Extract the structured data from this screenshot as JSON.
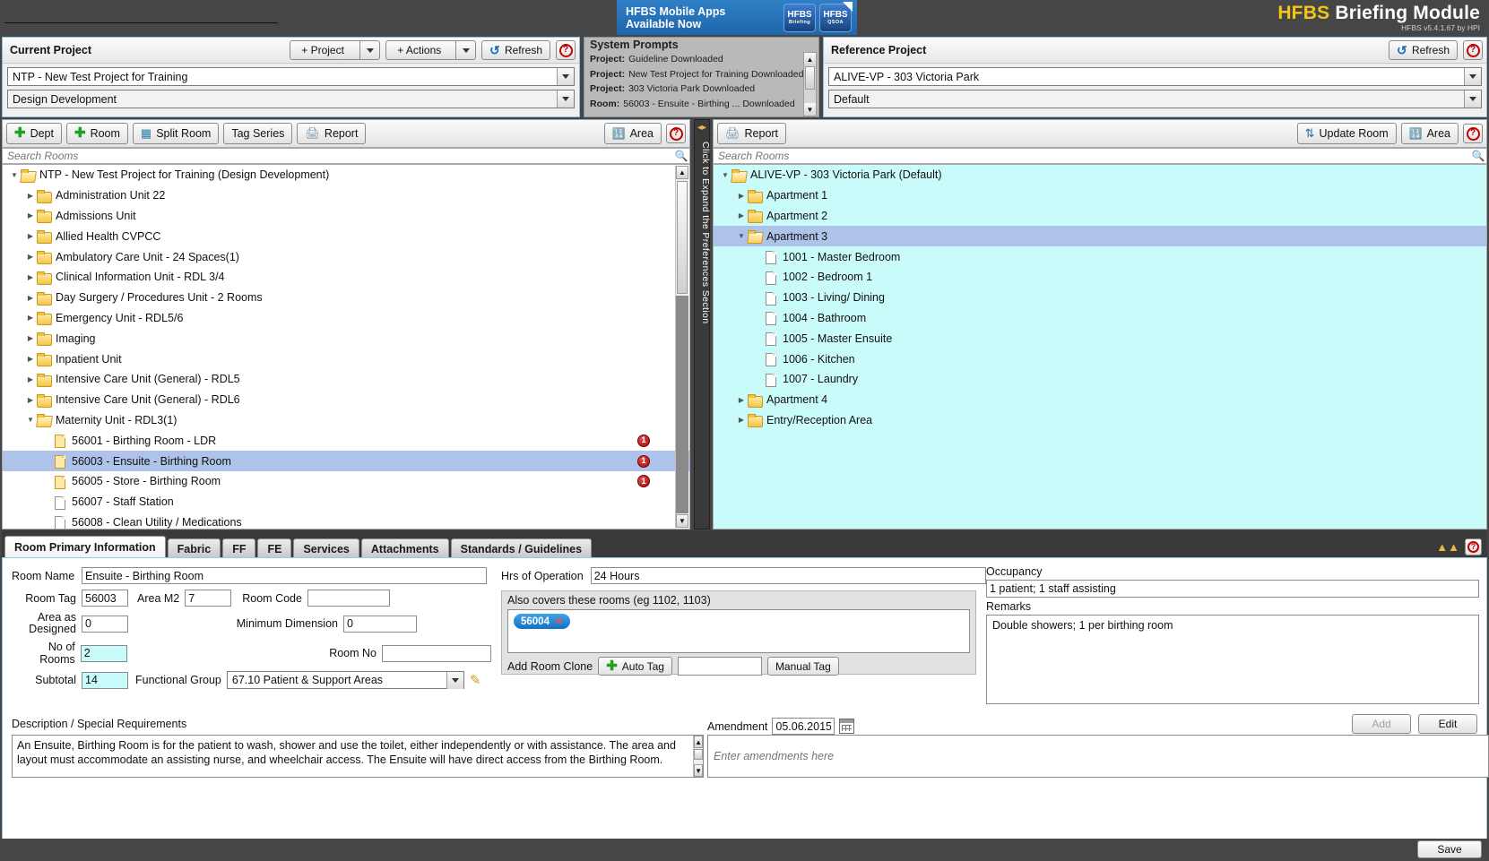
{
  "app": {
    "brand_prefix": "HFBS",
    "brand_title": "Briefing Module",
    "version": "HFBS v5.4.1.67 by HPI"
  },
  "promo": {
    "line1": "HFBS Mobile Apps",
    "line2": "Available Now",
    "icon1_label": "HFBS",
    "icon1_sub": "Briefing",
    "icon2_label": "HFBS",
    "icon2_sub": "QSOA"
  },
  "current_project": {
    "title": "Current Project",
    "add_project_label": "+ Project",
    "add_actions_label": "+ Actions",
    "refresh_label": "Refresh",
    "project_value": "NTP - New Test Project for Training",
    "stage_value": "Design Development"
  },
  "system_prompts": {
    "title": "System Prompts",
    "rows": [
      {
        "label": "Project:",
        "text": "Guideline Downloaded"
      },
      {
        "label": "Project:",
        "text": "New Test Project for Training  Downloaded"
      },
      {
        "label": "Project:",
        "text": "303 Victoria Park  Downloaded"
      },
      {
        "label": "Room:",
        "text": "56003 - Ensuite - Birthing ...  Downloaded"
      }
    ]
  },
  "reference_project": {
    "title": "Reference Project",
    "refresh_label": "Refresh",
    "project_value": "ALIVE-VP - 303 Victoria Park",
    "stage_value": "Default"
  },
  "left_toolbar": {
    "dept_label": "Dept",
    "room_label": "Room",
    "split_room_label": "Split Room",
    "tag_series_label": "Tag Series",
    "report_label": "Report",
    "area_label": "Area"
  },
  "right_toolbar": {
    "report_label": "Report",
    "update_room_label": "Update Room",
    "area_label": "Area"
  },
  "search": {
    "left_placeholder": "Search Rooms",
    "right_placeholder": "Search Rooms"
  },
  "splitter": {
    "label": "Click to Expand the Preferences Section"
  },
  "left_tree": [
    {
      "label": "NTP - New Test Project for Training (Design Development)",
      "indent": 0,
      "icon": "folder-open",
      "twisty": "down",
      "badge": ""
    },
    {
      "label": "Administration Unit 22",
      "indent": 1,
      "icon": "folder",
      "twisty": "right",
      "badge": ""
    },
    {
      "label": "Admissions Unit",
      "indent": 1,
      "icon": "folder",
      "twisty": "right",
      "badge": ""
    },
    {
      "label": "Allied Health CVPCC",
      "indent": 1,
      "icon": "folder",
      "twisty": "right",
      "badge": ""
    },
    {
      "label": "Ambulatory Care Unit - 24 Spaces(1)",
      "indent": 1,
      "icon": "folder",
      "twisty": "right",
      "badge": ""
    },
    {
      "label": "Clinical Information Unit - RDL 3/4",
      "indent": 1,
      "icon": "folder",
      "twisty": "right",
      "badge": ""
    },
    {
      "label": "Day Surgery / Procedures Unit - 2 Rooms",
      "indent": 1,
      "icon": "folder",
      "twisty": "right",
      "badge": ""
    },
    {
      "label": "Emergency Unit - RDL5/6",
      "indent": 1,
      "icon": "folder",
      "twisty": "right",
      "badge": ""
    },
    {
      "label": "Imaging",
      "indent": 1,
      "icon": "folder",
      "twisty": "right",
      "badge": ""
    },
    {
      "label": "Inpatient Unit",
      "indent": 1,
      "icon": "folder",
      "twisty": "right",
      "badge": ""
    },
    {
      "label": "Intensive Care Unit (General) - RDL5",
      "indent": 1,
      "icon": "folder",
      "twisty": "right",
      "badge": ""
    },
    {
      "label": "Intensive Care Unit (General) - RDL6",
      "indent": 1,
      "icon": "folder",
      "twisty": "right",
      "badge": ""
    },
    {
      "label": "Maternity Unit - RDL3(1)",
      "indent": 1,
      "icon": "folder-open",
      "twisty": "down",
      "badge": ""
    },
    {
      "label": "56001 - Birthing Room - LDR",
      "indent": 2,
      "icon": "page-yellow",
      "twisty": "",
      "badge": "1"
    },
    {
      "label": "56003 - Ensuite - Birthing Room",
      "indent": 2,
      "icon": "page-yellow",
      "twisty": "",
      "badge": "1",
      "selected": true
    },
    {
      "label": "56005 - Store - Birthing Room",
      "indent": 2,
      "icon": "page-yellow",
      "twisty": "",
      "badge": "1"
    },
    {
      "label": "56007 - Staff Station",
      "indent": 2,
      "icon": "page",
      "twisty": "",
      "badge": ""
    },
    {
      "label": "56008 - Clean Utility / Medications",
      "indent": 2,
      "icon": "page",
      "twisty": "",
      "badge": ""
    }
  ],
  "right_tree": [
    {
      "label": "ALIVE-VP - 303 Victoria Park (Default)",
      "indent": 0,
      "icon": "folder-open",
      "twisty": "down"
    },
    {
      "label": "Apartment 1",
      "indent": 1,
      "icon": "folder",
      "twisty": "right"
    },
    {
      "label": "Apartment 2",
      "indent": 1,
      "icon": "folder",
      "twisty": "right"
    },
    {
      "label": "Apartment 3",
      "indent": 1,
      "icon": "folder-open",
      "twisty": "down",
      "selected": true
    },
    {
      "label": "1001 - Master Bedroom",
      "indent": 2,
      "icon": "page",
      "twisty": ""
    },
    {
      "label": "1002 - Bedroom 1",
      "indent": 2,
      "icon": "page",
      "twisty": ""
    },
    {
      "label": "1003 - Living/ Dining",
      "indent": 2,
      "icon": "page",
      "twisty": ""
    },
    {
      "label": "1004 - Bathroom",
      "indent": 2,
      "icon": "page",
      "twisty": ""
    },
    {
      "label": "1005 - Master Ensuite",
      "indent": 2,
      "icon": "page",
      "twisty": ""
    },
    {
      "label": "1006 - Kitchen",
      "indent": 2,
      "icon": "page",
      "twisty": ""
    },
    {
      "label": "1007 - Laundry",
      "indent": 2,
      "icon": "page",
      "twisty": ""
    },
    {
      "label": "Apartment 4",
      "indent": 1,
      "icon": "folder",
      "twisty": "right"
    },
    {
      "label": "Entry/Reception Area",
      "indent": 1,
      "icon": "folder",
      "twisty": "right"
    }
  ],
  "tabs": [
    {
      "label": "Room Primary Information",
      "active": true
    },
    {
      "label": "Fabric",
      "active": false
    },
    {
      "label": "FF",
      "active": false
    },
    {
      "label": "FE",
      "active": false
    },
    {
      "label": "Services",
      "active": false
    },
    {
      "label": "Attachments",
      "active": false
    },
    {
      "label": "Standards / Guidelines",
      "active": false
    }
  ],
  "form": {
    "room_name_label": "Room Name",
    "room_name_value": "Ensuite - Birthing Room",
    "room_tag_label": "Room Tag",
    "room_tag_value": "56003",
    "area_m2_label": "Area M2",
    "area_m2_value": "7",
    "room_code_label": "Room Code",
    "room_code_value": "",
    "area_as_designed_label_1": "Area as",
    "area_as_designed_label_2": "Designed",
    "area_as_designed_value": "0",
    "minimum_dimension_label": "Minimum Dimension",
    "minimum_dimension_value": "0",
    "no_of_rooms_label": "No of Rooms",
    "no_of_rooms_value": "2",
    "room_no_label": "Room No",
    "room_no_value": "",
    "subtotal_label": "Subtotal",
    "subtotal_value": "14",
    "functional_group_label": "Functional Group",
    "functional_group_value": "67.10 Patient & Support Areas",
    "hrs_of_operation_label": "Hrs of Operation",
    "hrs_of_operation_value": "24 Hours",
    "also_covers_label": "Also covers these rooms (eg 1102, 1103)",
    "also_covers_chip": "56004",
    "add_room_clone_label": "Add Room Clone",
    "auto_tag_label": "Auto Tag",
    "manual_tag_label": "Manual Tag",
    "manual_tag_value": "",
    "occupancy_label": "Occupancy",
    "occupancy_value": "1 patient; 1 staff assisting",
    "remarks_label": "Remarks",
    "remarks_value": "Double showers; 1 per birthing room",
    "description_label": "Description / Special Requirements",
    "description_value": "An Ensuite, Birthing Room is for the patient to wash, shower and use the toilet, either independently or with assistance. The area and layout must accommodate an assisting nurse, and wheelchair access.  The Ensuite will have direct access from the Birthing Room.",
    "amendment_label": "Amendment",
    "amendment_date": "05.06.2015",
    "amendment_placeholder": "Enter amendments here",
    "add_label": "Add",
    "edit_label": "Edit"
  },
  "footer": {
    "save_label": "Save"
  },
  "colors": {
    "accent_blue": "#1f66ad",
    "brand_yellow": "#f5c518",
    "reference_tree_bg": "#c9fbfb",
    "selection_blue": "#aec3ea",
    "badge_red": "#a00d0d"
  }
}
